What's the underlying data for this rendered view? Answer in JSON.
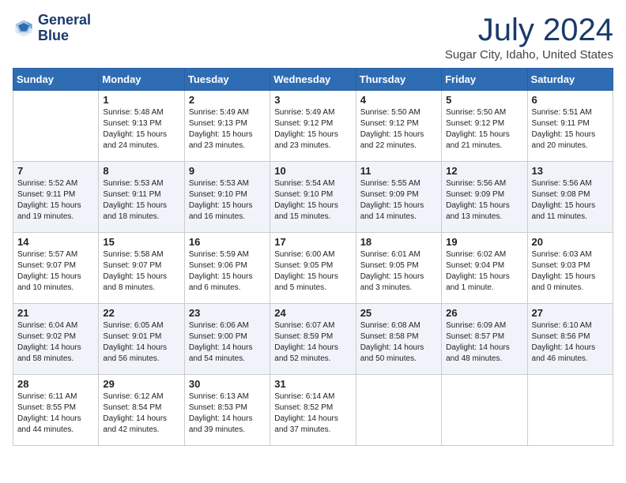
{
  "header": {
    "logo_line1": "General",
    "logo_line2": "Blue",
    "month": "July 2024",
    "location": "Sugar City, Idaho, United States"
  },
  "weekdays": [
    "Sunday",
    "Monday",
    "Tuesday",
    "Wednesday",
    "Thursday",
    "Friday",
    "Saturday"
  ],
  "weeks": [
    [
      {
        "day": null,
        "info": null
      },
      {
        "day": "1",
        "info": "Sunrise: 5:48 AM\nSunset: 9:13 PM\nDaylight: 15 hours\nand 24 minutes."
      },
      {
        "day": "2",
        "info": "Sunrise: 5:49 AM\nSunset: 9:13 PM\nDaylight: 15 hours\nand 23 minutes."
      },
      {
        "day": "3",
        "info": "Sunrise: 5:49 AM\nSunset: 9:12 PM\nDaylight: 15 hours\nand 23 minutes."
      },
      {
        "day": "4",
        "info": "Sunrise: 5:50 AM\nSunset: 9:12 PM\nDaylight: 15 hours\nand 22 minutes."
      },
      {
        "day": "5",
        "info": "Sunrise: 5:50 AM\nSunset: 9:12 PM\nDaylight: 15 hours\nand 21 minutes."
      },
      {
        "day": "6",
        "info": "Sunrise: 5:51 AM\nSunset: 9:11 PM\nDaylight: 15 hours\nand 20 minutes."
      }
    ],
    [
      {
        "day": "7",
        "info": "Sunrise: 5:52 AM\nSunset: 9:11 PM\nDaylight: 15 hours\nand 19 minutes."
      },
      {
        "day": "8",
        "info": "Sunrise: 5:53 AM\nSunset: 9:11 PM\nDaylight: 15 hours\nand 18 minutes."
      },
      {
        "day": "9",
        "info": "Sunrise: 5:53 AM\nSunset: 9:10 PM\nDaylight: 15 hours\nand 16 minutes."
      },
      {
        "day": "10",
        "info": "Sunrise: 5:54 AM\nSunset: 9:10 PM\nDaylight: 15 hours\nand 15 minutes."
      },
      {
        "day": "11",
        "info": "Sunrise: 5:55 AM\nSunset: 9:09 PM\nDaylight: 15 hours\nand 14 minutes."
      },
      {
        "day": "12",
        "info": "Sunrise: 5:56 AM\nSunset: 9:09 PM\nDaylight: 15 hours\nand 13 minutes."
      },
      {
        "day": "13",
        "info": "Sunrise: 5:56 AM\nSunset: 9:08 PM\nDaylight: 15 hours\nand 11 minutes."
      }
    ],
    [
      {
        "day": "14",
        "info": "Sunrise: 5:57 AM\nSunset: 9:07 PM\nDaylight: 15 hours\nand 10 minutes."
      },
      {
        "day": "15",
        "info": "Sunrise: 5:58 AM\nSunset: 9:07 PM\nDaylight: 15 hours\nand 8 minutes."
      },
      {
        "day": "16",
        "info": "Sunrise: 5:59 AM\nSunset: 9:06 PM\nDaylight: 15 hours\nand 6 minutes."
      },
      {
        "day": "17",
        "info": "Sunrise: 6:00 AM\nSunset: 9:05 PM\nDaylight: 15 hours\nand 5 minutes."
      },
      {
        "day": "18",
        "info": "Sunrise: 6:01 AM\nSunset: 9:05 PM\nDaylight: 15 hours\nand 3 minutes."
      },
      {
        "day": "19",
        "info": "Sunrise: 6:02 AM\nSunset: 9:04 PM\nDaylight: 15 hours\nand 1 minute."
      },
      {
        "day": "20",
        "info": "Sunrise: 6:03 AM\nSunset: 9:03 PM\nDaylight: 15 hours\nand 0 minutes."
      }
    ],
    [
      {
        "day": "21",
        "info": "Sunrise: 6:04 AM\nSunset: 9:02 PM\nDaylight: 14 hours\nand 58 minutes."
      },
      {
        "day": "22",
        "info": "Sunrise: 6:05 AM\nSunset: 9:01 PM\nDaylight: 14 hours\nand 56 minutes."
      },
      {
        "day": "23",
        "info": "Sunrise: 6:06 AM\nSunset: 9:00 PM\nDaylight: 14 hours\nand 54 minutes."
      },
      {
        "day": "24",
        "info": "Sunrise: 6:07 AM\nSunset: 8:59 PM\nDaylight: 14 hours\nand 52 minutes."
      },
      {
        "day": "25",
        "info": "Sunrise: 6:08 AM\nSunset: 8:58 PM\nDaylight: 14 hours\nand 50 minutes."
      },
      {
        "day": "26",
        "info": "Sunrise: 6:09 AM\nSunset: 8:57 PM\nDaylight: 14 hours\nand 48 minutes."
      },
      {
        "day": "27",
        "info": "Sunrise: 6:10 AM\nSunset: 8:56 PM\nDaylight: 14 hours\nand 46 minutes."
      }
    ],
    [
      {
        "day": "28",
        "info": "Sunrise: 6:11 AM\nSunset: 8:55 PM\nDaylight: 14 hours\nand 44 minutes."
      },
      {
        "day": "29",
        "info": "Sunrise: 6:12 AM\nSunset: 8:54 PM\nDaylight: 14 hours\nand 42 minutes."
      },
      {
        "day": "30",
        "info": "Sunrise: 6:13 AM\nSunset: 8:53 PM\nDaylight: 14 hours\nand 39 minutes."
      },
      {
        "day": "31",
        "info": "Sunrise: 6:14 AM\nSunset: 8:52 PM\nDaylight: 14 hours\nand 37 minutes."
      },
      {
        "day": null,
        "info": null
      },
      {
        "day": null,
        "info": null
      },
      {
        "day": null,
        "info": null
      }
    ]
  ]
}
